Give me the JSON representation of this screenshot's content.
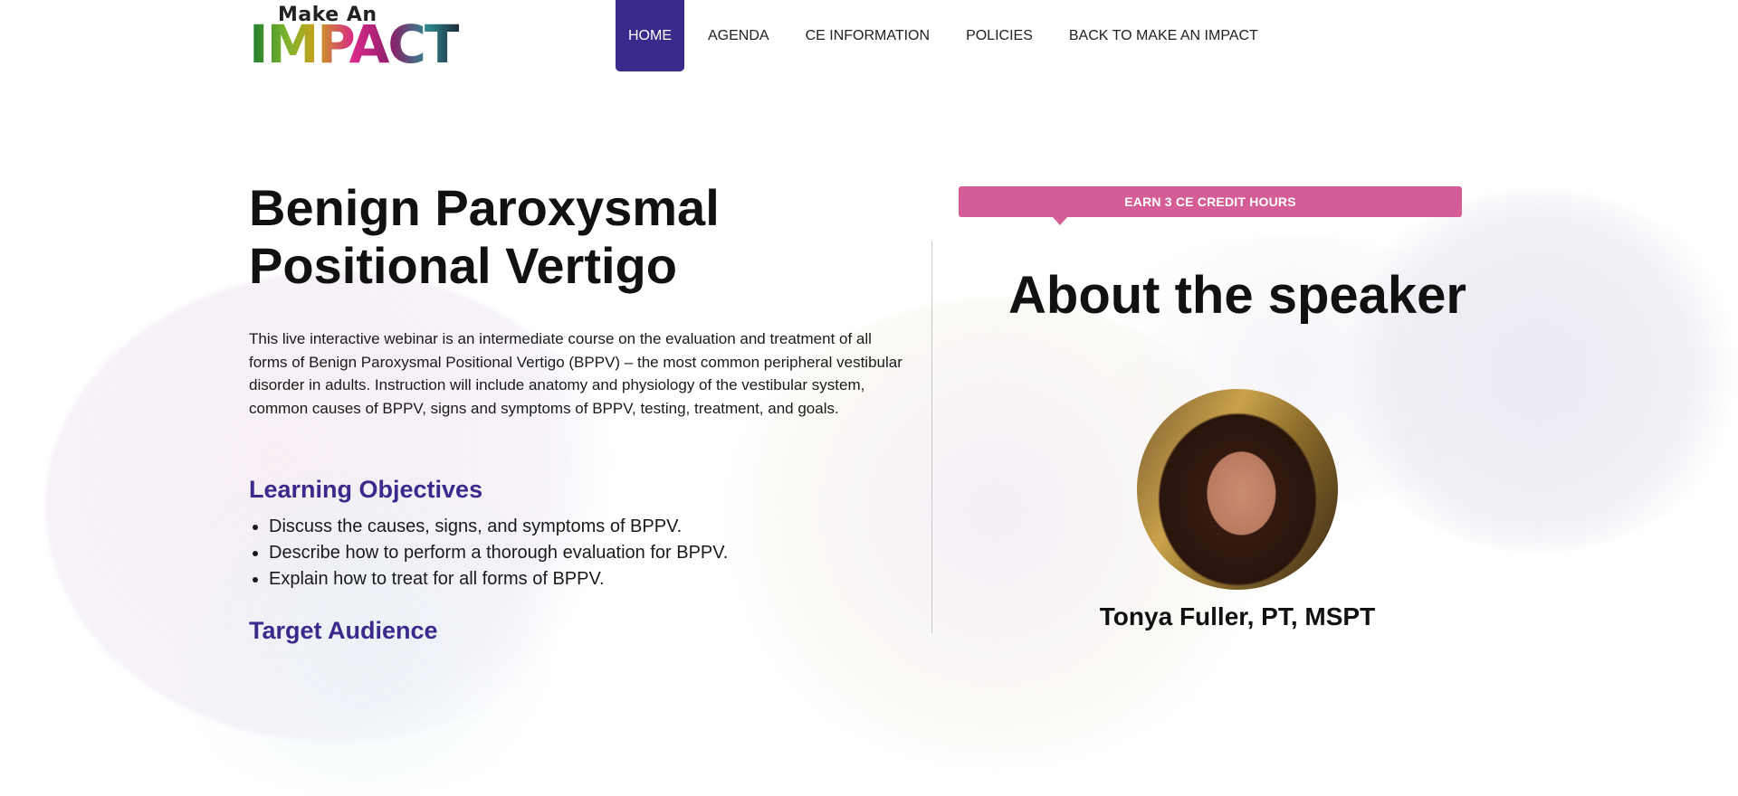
{
  "header": {
    "logo": {
      "line1": "Make An",
      "line2": "IMPACT"
    },
    "nav": [
      {
        "label": "HOME",
        "active": true
      },
      {
        "label": "AGENDA",
        "active": false
      },
      {
        "label": "CE INFORMATION",
        "active": false
      },
      {
        "label": "POLICIES",
        "active": false
      },
      {
        "label": "BACK TO MAKE AN IMPACT",
        "active": false
      }
    ]
  },
  "course": {
    "title": "Benign Paroxysmal Positional Vertigo",
    "intro": "This live interactive webinar is an intermediate course on the evaluation and treatment of all forms of Benign Paroxysmal Positional Vertigo (BPPV) – the most common peripheral vestibular disorder in adults. Instruction will include anatomy and physiology of the vestibular system, common causes of BPPV, signs and symptoms of BPPV, testing, treatment, and goals.",
    "objectives_heading": "Learning Objectives",
    "objectives": [
      "Discuss the causes, signs, and symptoms of BPPV.",
      "Describe how to perform a thorough evaluation for BPPV.",
      "Explain how to treat for all forms of BPPV."
    ],
    "next_heading_partial": "Target Audience"
  },
  "speaker": {
    "credit_banner": "EARN 3 CE CREDIT HOURS",
    "heading": "About the speaker",
    "name": "Tonya Fuller, PT, MSPT"
  },
  "colors": {
    "brand_purple": "#3b2a8c",
    "banner_pink": "#d45c97"
  }
}
